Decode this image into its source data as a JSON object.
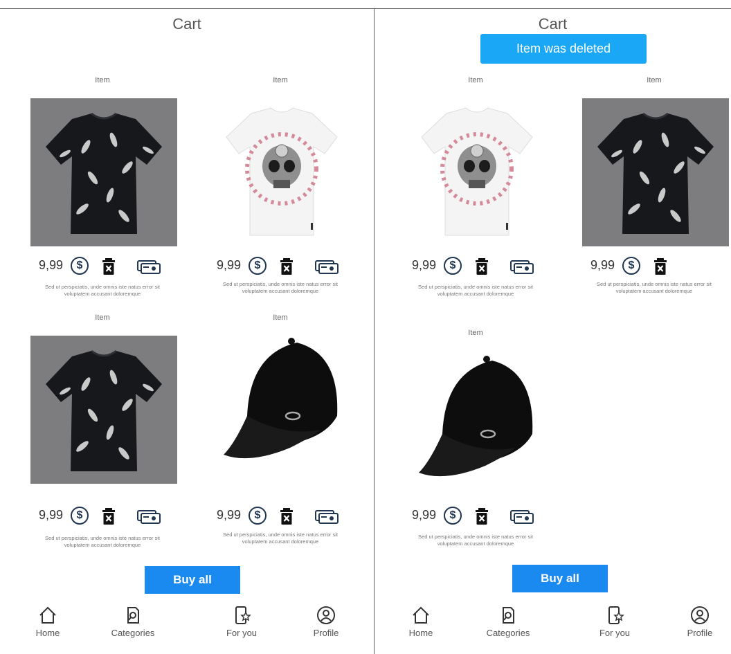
{
  "left_screen": {
    "title": "Cart",
    "items": [
      {
        "label": "Item",
        "price": "9,99",
        "description": "Sed ut perspiciatis, unde omnis iste natus error sit voluptatem accusant doloremque",
        "image": "black-feather-tshirt"
      },
      {
        "label": "Item",
        "price": "9,99",
        "description": "Sed ut perspiciatis, unde omnis iste natus error sit voluptatem accusant doloremque",
        "image": "white-skull-tshirt"
      },
      {
        "label": "Item",
        "price": "9,99",
        "description": "Sed ut perspiciatis, unde omnis iste natus error sit voluptatem accusant doloremque",
        "image": "black-feather-tshirt"
      },
      {
        "label": "Item",
        "price": "9,99",
        "description": "Sed ut perspiciatis, unde omnis iste natus error sit voluptatem accusant doloremque",
        "image": "black-cap"
      }
    ],
    "buy_all_label": "Buy all"
  },
  "right_screen": {
    "title": "Cart",
    "toast": "Item was deleted",
    "items": [
      {
        "label": "Item",
        "price": "9,99",
        "description": "Sed ut perspiciatis, unde omnis iste natus error sit voluptatem accusant doloremque",
        "image": "white-skull-tshirt"
      },
      {
        "label": "Item",
        "price": "9,99",
        "description": "Sed ut perspiciatis, unde omnis iste natus error sit voluptatem accusant doloremque",
        "image": "black-feather-tshirt"
      },
      {
        "label": "Item",
        "price": "9,99",
        "description": "Sed ut perspiciatis, unde omnis iste natus error sit voluptatem accusant doloremque",
        "image": "black-cap"
      }
    ],
    "buy_all_label": "Buy all"
  },
  "nav": {
    "home": "Home",
    "categories": "Categories",
    "for_you": "For you",
    "profile": "Profile"
  },
  "colors": {
    "toast": "#1aa7f5",
    "button": "#1a8af0",
    "icon_dark": "#1f3550"
  }
}
